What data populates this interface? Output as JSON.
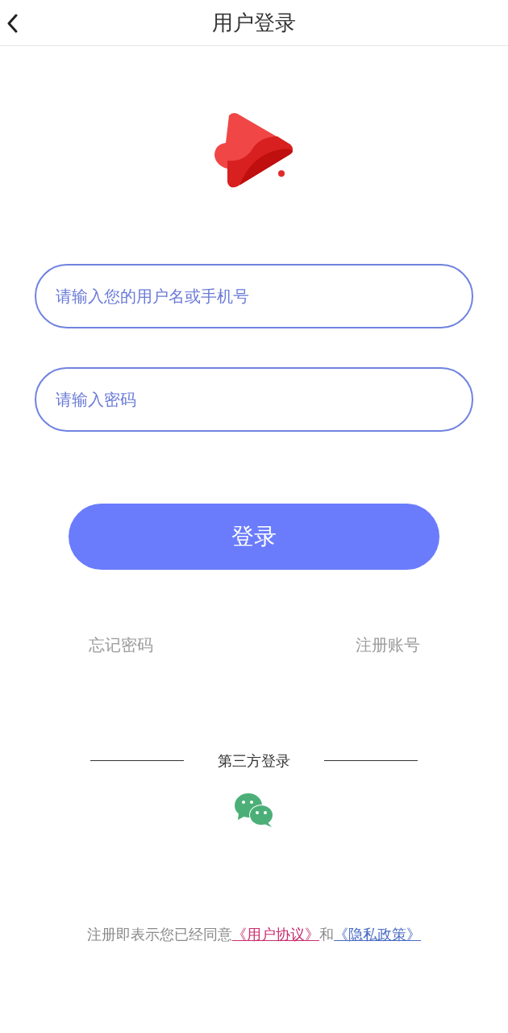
{
  "header": {
    "title": "用户登录"
  },
  "fields": [
    {
      "placeholder": "请输入您的用户名或手机号"
    },
    {
      "placeholder": "请输入密码"
    }
  ],
  "login_button": "登录",
  "links": {
    "forgot": "忘记密码",
    "register": "注册账号"
  },
  "third_party": {
    "label": "第三方登录"
  },
  "agreement": [
    {
      "kind": "text",
      "text": "注册即表示您已经同意"
    },
    {
      "kind": "link",
      "text": "《用户协议》",
      "color": "#c8306e"
    },
    {
      "kind": "text",
      "text": "和"
    },
    {
      "kind": "link",
      "text": "《隐私政策》",
      "color": "#4a6cc4"
    }
  ]
}
